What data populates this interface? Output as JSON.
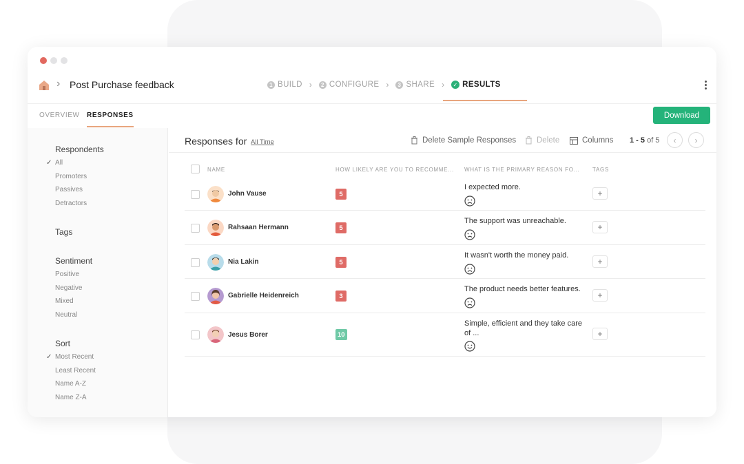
{
  "window": {
    "title": "Post Purchase feedback"
  },
  "steps": [
    {
      "num": "1",
      "label": "BUILD",
      "active": false
    },
    {
      "num": "2",
      "label": "CONFIGURE",
      "active": false
    },
    {
      "num": "3",
      "label": "SHARE",
      "active": false
    },
    {
      "num": "",
      "label": "RESULTS",
      "active": true
    }
  ],
  "subnav": {
    "tabs": [
      "OVERVIEW",
      "RESPONSES"
    ],
    "active": "RESPONSES",
    "download_label": "Download"
  },
  "sidebar": {
    "groups": [
      {
        "heading": "Respondents",
        "items": [
          "All",
          "Promoters",
          "Passives",
          "Detractors"
        ],
        "selected": "All"
      },
      {
        "heading": "Tags",
        "items": [],
        "selected": ""
      },
      {
        "heading": "Sentiment",
        "items": [
          "Positive",
          "Negative",
          "Mixed",
          "Neutral"
        ],
        "selected": ""
      },
      {
        "heading": "Sort",
        "items": [
          "Most Recent",
          "Least Recent",
          "Name A-Z",
          "Name Z-A"
        ],
        "selected": "Most Recent"
      }
    ]
  },
  "main": {
    "title": "Responses for",
    "range_link": "All Time",
    "delete_sample_label": "Delete Sample Responses",
    "delete_label": "Delete",
    "columns_label": "Columns",
    "pager": {
      "range": "1 - 5",
      "of": "of 5"
    }
  },
  "table": {
    "headers": [
      "NAME",
      "HOW LIKELY ARE YOU TO RECOMME...",
      "WHAT IS THE PRIMARY REASON FO...",
      "TAGS"
    ],
    "rows": [
      {
        "name": "John Vause",
        "score": "5",
        "reason": "I expected more.",
        "sentiment": "sad-face-icon"
      },
      {
        "name": "Rahsaan Hermann",
        "score": "5",
        "reason": "The support was unreachable.",
        "sentiment": "sad-face-icon"
      },
      {
        "name": "Nia Lakin",
        "score": "5",
        "reason": "It wasn't worth the money paid.",
        "sentiment": "sad-face-icon"
      },
      {
        "name": "Gabrielle Heidenreich",
        "score": "3",
        "reason": "The product needs better features.",
        "sentiment": "sad-face-icon"
      },
      {
        "name": "Jesus Borer",
        "score": "10",
        "reason": "Simple, efficient and they take care of ...",
        "sentiment": "happy-face-icon"
      }
    ]
  },
  "colors": {
    "accent": "#24b37a",
    "detractor": "#df6b66",
    "promoter": "#6fc9a6",
    "tab_underline": "#e8a57e"
  }
}
